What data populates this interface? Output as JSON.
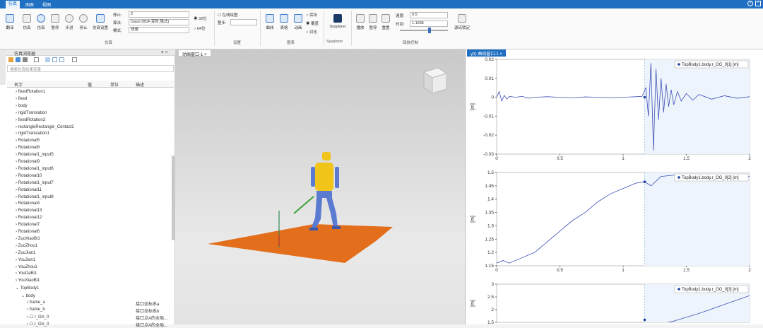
{
  "menu": {
    "items": [
      "仿真",
      "图表",
      "视图"
    ]
  },
  "ribbon": {
    "buttons": [
      "翻译",
      "仿真",
      "暂停",
      "步进",
      "停止",
      "仿真设置"
    ],
    "fields": {
      "stop_label": "停止:",
      "stop_value": "2",
      "algo_label": "算法:",
      "algo_value": "Dassl (BDF,变阶,隐式)",
      "mode_label": "模式:",
      "mode_value": "快速",
      "bit32": "32位",
      "bit64": "64位",
      "online_label": "在线绘图",
      "step_label": "整步:"
    },
    "chart_buttons": [
      "曲线",
      "表格",
      "动画"
    ],
    "radios": [
      "保持",
      "覆盖",
      "对比"
    ],
    "sysplorer": "Sysplorer",
    "playback": [
      "播放",
      "暂停",
      "重置"
    ],
    "speed_label": "速度:",
    "speed_value": "0.5",
    "time_label": "时间:",
    "time_value": "1.1685",
    "sync": "源码锁定",
    "groups": [
      "仿真",
      "设置",
      "图表",
      "Sysplorer",
      "回放控制"
    ]
  },
  "left": {
    "title": "仿真浏览器",
    "search_placeholder": "搜索仿真结果变量",
    "headers": [
      "名字",
      "值",
      "单位",
      "描述"
    ],
    "items": [
      "fixedRotation1",
      "fixed",
      "body",
      "rigidTranslation",
      "fixedRotation3",
      "rectangleRectangle_Contact2",
      "rigidTranslation1",
      "Rotational5",
      "Rotational8",
      "Rotational1_input5",
      "Rotational9",
      "Rotational1_input6",
      "Rotational10",
      "Rotational1_input7",
      "Rotational11",
      "Rotational1_input8",
      "Rotational4",
      "Rotational13",
      "Rotational12",
      "Rotational7",
      "Rotational6",
      "ZuoXiaoBi1",
      "ZuoZhou1",
      "ZuoJian1",
      "YouJian1",
      "YouZhou1",
      "YouDaBi1",
      "YouXiaoBi1",
      "TopBody1"
    ],
    "sub": {
      "body": "body",
      "rows": [
        {
          "name": "frame_a",
          "desc": "接口坐标系a"
        },
        {
          "name": "frame_b",
          "desc": "接口坐标系b"
        },
        {
          "name": "r_OA_0",
          "desc": "接口点A的全局..."
        },
        {
          "name": "r_OA_0",
          "desc": "接口点A的全局..."
        }
      ]
    }
  },
  "viewport": {
    "tab": "动画窗口-1"
  },
  "plots": {
    "tab": "y(t) 曲线窗口-1"
  },
  "chart_data": [
    {
      "type": "line",
      "legend": "TopBody1.body.r_OG_0[1] [m]",
      "ylabel": "[m]",
      "xlim": [
        0,
        2
      ],
      "ylim": [
        -0.03,
        0.02
      ],
      "xticks": [
        0.0,
        0.5,
        1.0,
        1.5,
        2.0
      ],
      "yticks": [
        0.02,
        0.01,
        0.0,
        -0.01,
        -0.02,
        -0.03
      ],
      "cursor_x": 1.17,
      "shaded_from": 1.17,
      "x": [
        0,
        0.02,
        0.04,
        0.06,
        0.08,
        0.1,
        0.15,
        0.2,
        0.25,
        0.3,
        0.4,
        0.5,
        0.6,
        0.7,
        0.8,
        0.9,
        1.0,
        1.1,
        1.15,
        1.18,
        1.2,
        1.22,
        1.24,
        1.26,
        1.28,
        1.3,
        1.32,
        1.34,
        1.36,
        1.38,
        1.4,
        1.43,
        1.46,
        1.5,
        1.55,
        1.6,
        1.7,
        1.8,
        1.9,
        2.0
      ],
      "y": [
        0,
        0.003,
        -0.002,
        0.001,
        -0.001,
        0.0005,
        0,
        0.0005,
        -0.0005,
        0,
        0.0003,
        0,
        -0.0003,
        0.0002,
        0,
        -0.0002,
        0,
        0.0003,
        0.0005,
        0.005,
        -0.01,
        0.018,
        -0.028,
        0.015,
        -0.012,
        0.01,
        -0.008,
        0.007,
        -0.005,
        0.004,
        -0.004,
        0.003,
        -0.002,
        0.002,
        -0.0015,
        0.0015,
        -0.001,
        0.0008,
        -0.0005,
        0.0003
      ]
    },
    {
      "type": "line",
      "legend": "TopBody1.body.r_OG_0[2] [m]",
      "ylabel": "[m]",
      "xlim": [
        0,
        2
      ],
      "ylim": [
        1.15,
        1.5
      ],
      "xticks": [
        0.0,
        0.5,
        1.0,
        1.5,
        2.0
      ],
      "yticks": [
        1.5,
        1.45,
        1.4,
        1.35,
        1.3,
        1.25,
        1.2,
        1.15
      ],
      "cursor_x": 1.17,
      "shaded_from": 1.17,
      "x": [
        0,
        0.05,
        0.1,
        0.2,
        0.3,
        0.4,
        0.5,
        0.6,
        0.7,
        0.8,
        0.9,
        1.0,
        1.1,
        1.17,
        1.22,
        1.3,
        1.4,
        1.5,
        1.6,
        1.7,
        1.8,
        1.9,
        2.0
      ],
      "y": [
        1.16,
        1.17,
        1.16,
        1.18,
        1.2,
        1.24,
        1.28,
        1.32,
        1.35,
        1.39,
        1.42,
        1.44,
        1.46,
        1.465,
        1.45,
        1.485,
        1.49,
        1.49,
        1.48,
        1.49,
        1.48,
        1.49,
        1.485
      ]
    },
    {
      "type": "line",
      "legend": "TopBody1.body.r_OG_0[3] [m]",
      "ylabel": "[m]",
      "xlim": [
        0,
        2
      ],
      "ylim": [
        1.5,
        3.0
      ],
      "yticks": [
        3.0,
        2.5,
        2.0,
        1.5
      ],
      "cursor_x": 1.17,
      "shaded_from": 1.17,
      "x": [
        1.2,
        1.4,
        1.6,
        1.8,
        2.0
      ],
      "y": [
        1.3,
        1.55,
        1.85,
        2.2,
        2.55
      ]
    }
  ]
}
